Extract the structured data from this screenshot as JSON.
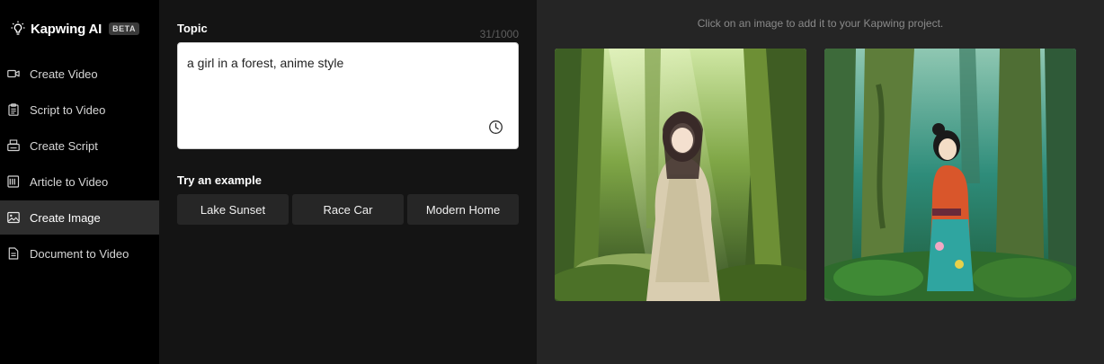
{
  "brand": {
    "name": "Kapwing AI",
    "badge": "BETA"
  },
  "sidebar": {
    "items": [
      {
        "label": "Create Video",
        "icon": "video-camera-icon",
        "active": false
      },
      {
        "label": "Script to Video",
        "icon": "clipboard-icon",
        "active": false
      },
      {
        "label": "Create Script",
        "icon": "typewriter-icon",
        "active": false
      },
      {
        "label": "Article to Video",
        "icon": "newspaper-icon",
        "active": false
      },
      {
        "label": "Create Image",
        "icon": "image-icon",
        "active": true
      },
      {
        "label": "Document to Video",
        "icon": "document-icon",
        "active": false
      }
    ]
  },
  "topic": {
    "label": "Topic",
    "value": "a girl in a forest, anime style",
    "char_count": "31/1000"
  },
  "examples": {
    "label": "Try an example",
    "items": [
      "Lake Sunset",
      "Race Car",
      "Modern Home"
    ]
  },
  "results": {
    "hint": "Click on an image to add it to your Kapwing project.",
    "images": [
      {
        "alt": "anime girl in pale dress in green sunlit forest"
      },
      {
        "alt": "anime girl in red kimono in teal mossy forest"
      }
    ]
  },
  "colors": {
    "sidebar_bg": "#000000",
    "panel_bg": "#141414",
    "results_bg": "#252525",
    "active_nav_bg": "#2e2e2e",
    "example_btn_bg": "#262626"
  }
}
